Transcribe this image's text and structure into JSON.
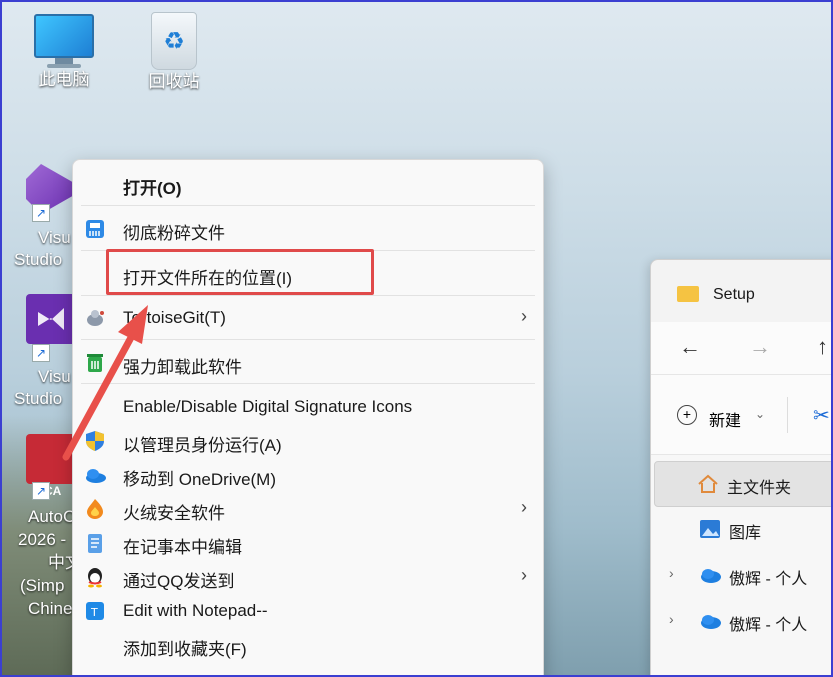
{
  "desktop": {
    "icons": [
      {
        "label": "此电脑",
        "icon": "computer-icon"
      },
      {
        "label": "回收站",
        "icon": "recycle-bin-icon"
      }
    ],
    "side_labels": {
      "vs1_a": "Visu",
      "vs1_b": "Studio",
      "vs2_a": "Visu",
      "vs2_b": "Studio",
      "acad_badge": "CA",
      "acad_a": "AutoC",
      "acad_b": "2026 -",
      "acad_c": "中文",
      "acad_d": "(Simp",
      "acad_e": "Chine"
    }
  },
  "context_menu": {
    "items": [
      {
        "label": "打开(O)",
        "icon": "",
        "bold": true
      },
      {
        "label": "彻底粉碎文件",
        "icon": "shredder-icon"
      },
      {
        "label": "打开文件所在的位置(I)",
        "icon": "",
        "highlighted": true
      },
      {
        "label": "TortoiseGit(T)",
        "icon": "tortoisegit-icon",
        "submenu": true
      },
      {
        "label": "强力卸载此软件",
        "icon": "uninstall-icon"
      },
      {
        "label": "Enable/Disable Digital Signature Icons",
        "icon": ""
      },
      {
        "label": "以管理员身份运行(A)",
        "icon": "shield-icon"
      },
      {
        "label": "移动到 OneDrive(M)",
        "icon": "onedrive-icon"
      },
      {
        "label": "火绒安全软件",
        "icon": "huorong-icon",
        "submenu": true
      },
      {
        "label": "在记事本中编辑",
        "icon": "notepad-icon"
      },
      {
        "label": "通过QQ发送到",
        "icon": "qq-icon",
        "submenu": true
      },
      {
        "label": "Edit with Notepad--",
        "icon": "notepad-dash-icon"
      },
      {
        "label": "添加到收藏夹(F)",
        "icon": ""
      }
    ],
    "chevron": "›"
  },
  "explorer": {
    "tab_title": "Setup",
    "nav": {
      "back": "←",
      "forward": "→",
      "up": "↑"
    },
    "toolbar": {
      "new_label": "新建",
      "new_caret": "⌄",
      "plus": "+",
      "cut": "✂"
    },
    "nav_items": [
      {
        "label": "主文件夹",
        "icon": "home-icon",
        "selected": true
      },
      {
        "label": "图库",
        "icon": "gallery-icon"
      },
      {
        "label": "傲辉 - 个人",
        "icon": "onedrive-icon",
        "expandable": true
      },
      {
        "label": "傲辉 - 个人",
        "icon": "onedrive-icon",
        "expandable": true
      }
    ],
    "expand_chevron": "›"
  },
  "colors": {
    "highlight_border": "#e04a4a",
    "arrow": "#e8504a",
    "frame_border": "#3b3fd1"
  }
}
